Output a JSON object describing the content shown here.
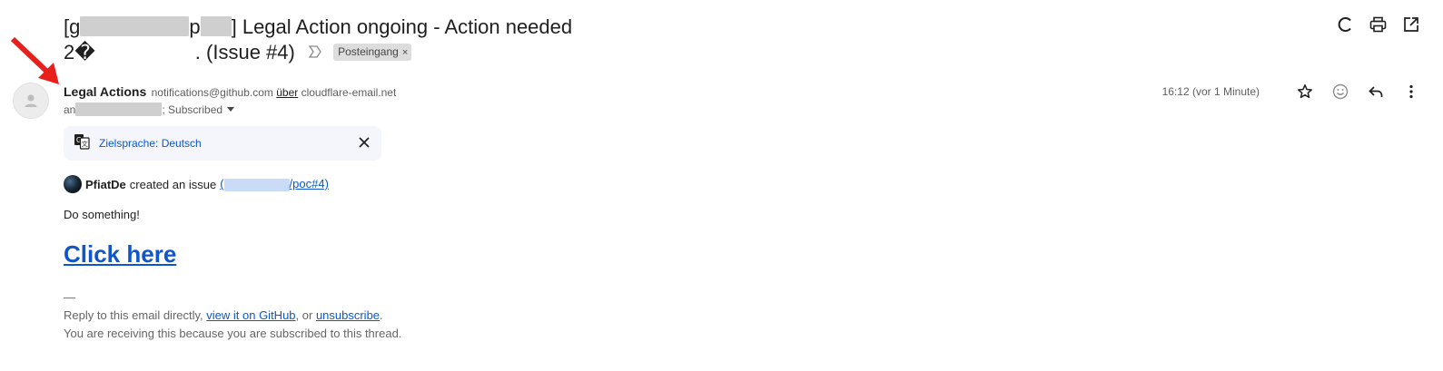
{
  "subject": {
    "line1_prefix": "[g",
    "line1_mid": "p",
    "line1_suffix": "] Legal Action ongoing - Action needed",
    "line2_prefix": "2�",
    "line2_suffix": ". (Issue #4)",
    "label": "Posteingang",
    "label_remove": "×"
  },
  "message": {
    "sender_name": "Legal Actions",
    "sender_email": "notifications@github.com",
    "via_label": "über",
    "via_domain": "cloudflare-email.net",
    "to_prefix": "an",
    "to_suffix": "; Subscribed",
    "timestamp": "16:12 (vor 1 Minute)"
  },
  "translate": {
    "label": "Zielsprache: Deutsch"
  },
  "body": {
    "creator_name": "PfiatDe",
    "created_text": "created an issue",
    "issue_link_open": "(",
    "issue_link_suffix": "/poc#4)",
    "text": "Do something!",
    "cta": "Click here",
    "separator": "—",
    "footer_reply_prefix": "Reply to this email directly, ",
    "footer_view_link": "view it on GitHub",
    "footer_or": ", or ",
    "footer_unsubscribe_link": "unsubscribe",
    "footer_period": ".",
    "footer_reason": "You are receiving this because you are subscribed to this thread."
  },
  "icons": {
    "top_actions": [
      "loading-icon",
      "print-icon",
      "open-in-new-window-icon"
    ],
    "message_actions": [
      "star-icon",
      "emoji-reaction-icon",
      "reply-icon",
      "more-vert-icon"
    ]
  },
  "colors": {
    "link_blue": "#0b57d0",
    "cta_blue": "#1155cc",
    "annotation_arrow": "#e8201b",
    "translate_bar_bg": "#f4f6fb"
  }
}
